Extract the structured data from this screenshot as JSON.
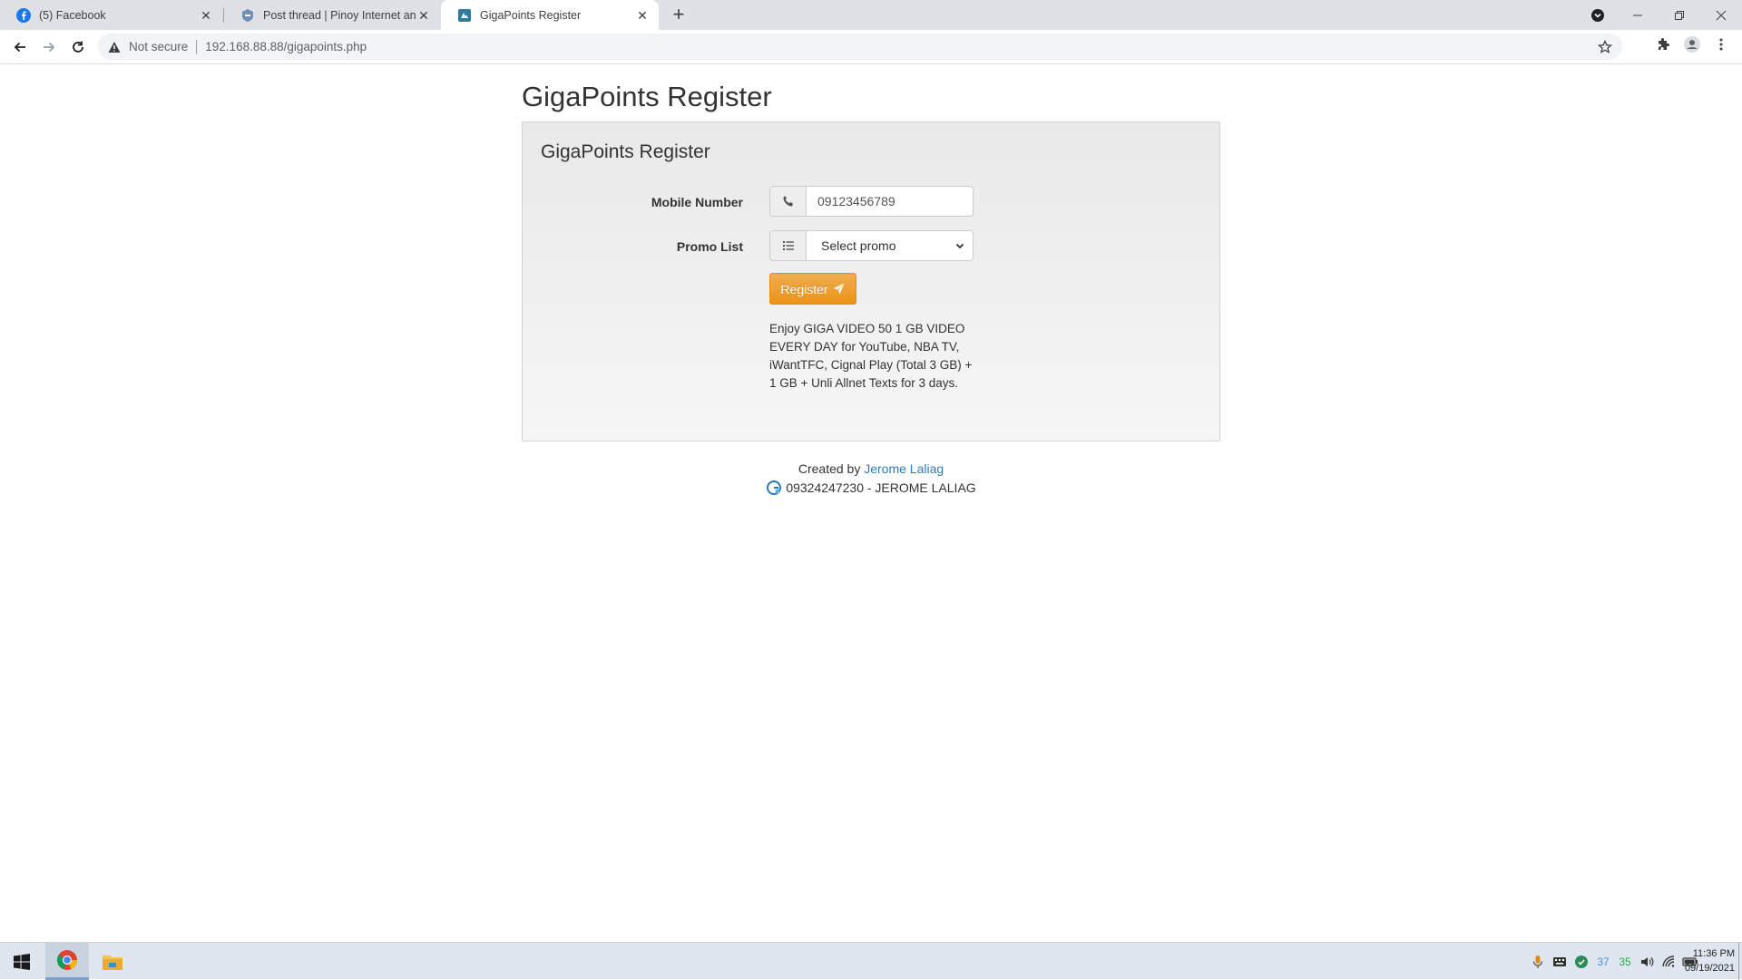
{
  "browser": {
    "tabs": [
      {
        "title": "(5) Facebook",
        "icon": "facebook-icon",
        "active": false
      },
      {
        "title": "Post thread | Pinoy Internet and T",
        "icon": "forum-icon",
        "active": false
      },
      {
        "title": "GigaPoints Register",
        "icon": "site-icon",
        "active": true
      }
    ],
    "security_label": "Not secure",
    "url": "192.168.88.88/gigapoints.php"
  },
  "page": {
    "heading": "GigaPoints Register",
    "panel_title": "GigaPoints Register",
    "form": {
      "mobile_label": "Mobile Number",
      "mobile_value": "09123456789",
      "promo_label": "Promo List",
      "promo_selected": "Select promo",
      "register_label": "Register"
    },
    "promo_description": "Enjoy GIGA VIDEO 50 1 GB VIDEO EVERY DAY for YouTube, NBA TV, iWantTFC, Cignal Play (Total 3 GB) + 1 GB + Unli Allnet Texts for 3 days.",
    "footer": {
      "created_by": "Created by",
      "author": "Jerome Laliag",
      "contact": "09324247230 - JEROME LALIAG"
    }
  },
  "taskbar": {
    "tray_numbers": [
      "37",
      "35"
    ],
    "time": "11:36 PM",
    "date": "09/19/2021"
  },
  "colors": {
    "register_button": "#f0ad4e",
    "link": "#337ab7"
  }
}
